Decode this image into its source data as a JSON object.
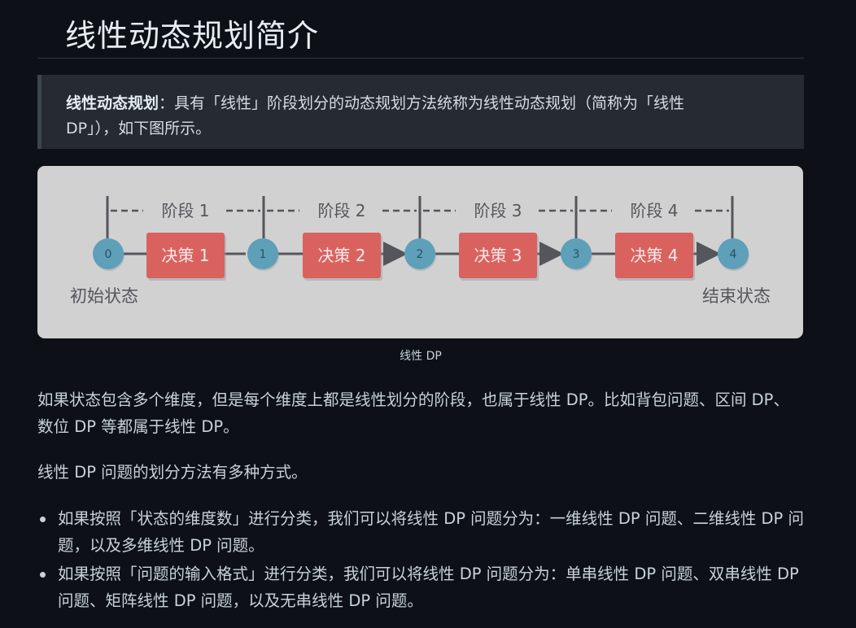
{
  "heading": "线性动态规划简介",
  "callout": {
    "term": "线性动态规划",
    "text": "：具有「线性」阶段划分的动态规划方法统称为线性动态规划（简称为「线性 DP」），如下图所示。"
  },
  "diagram": {
    "stages": [
      "阶段 1",
      "阶段 2",
      "阶段 3",
      "阶段 4"
    ],
    "decisions": [
      "决策 1",
      "决策 2",
      "决策 3",
      "决策 4"
    ],
    "states": [
      "0",
      "1",
      "2",
      "3",
      "4"
    ],
    "start_label": "初始状态",
    "end_label": "结束状态",
    "colors": {
      "state_circle": "#5e9fb9",
      "decision_box": "#d9625f",
      "line": "#55555c",
      "label": "#55555c"
    }
  },
  "caption": "线性 DP",
  "paragraphs": [
    "如果状态包含多个维度，但是每个维度上都是线性划分的阶段，也属于线性 DP。比如背包问题、区间 DP、数位 DP 等都属于线性 DP。",
    "线性 DP 问题的划分方法有多种方式。"
  ],
  "bullets": [
    "如果按照「状态的维度数」进行分类，我们可以将线性 DP 问题分为：一维线性 DP 问题、二维线性 DP 问题，以及多维线性 DP 问题。",
    "如果按照「问题的输入格式」进行分类，我们可以将线性 DP 问题分为：单串线性 DP 问题、双串线性 DP 问题、矩阵线性 DP 问题，以及无串线性 DP 问题。"
  ]
}
